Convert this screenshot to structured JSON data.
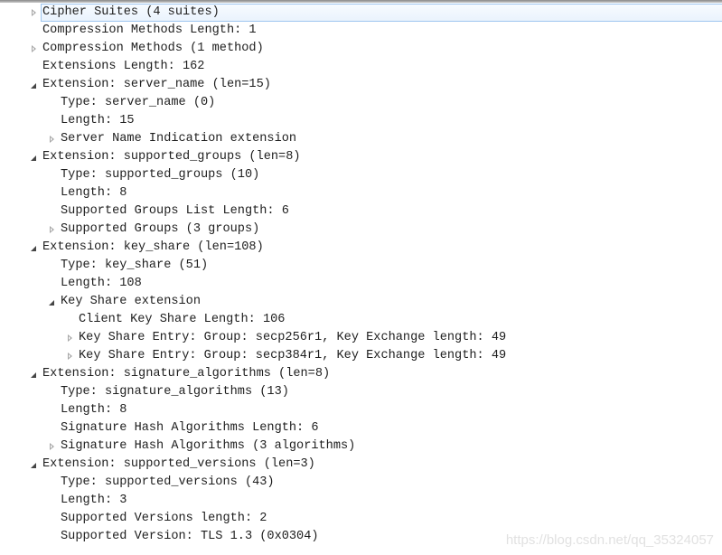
{
  "tree": {
    "rows": [
      {
        "level": 0,
        "toggle": "collapsed",
        "selected": true,
        "text": "Cipher Suites (4 suites)"
      },
      {
        "level": 0,
        "toggle": "none",
        "selected": false,
        "text": "Compression Methods Length: 1"
      },
      {
        "level": 0,
        "toggle": "collapsed",
        "selected": false,
        "text": "Compression Methods (1 method)"
      },
      {
        "level": 0,
        "toggle": "none",
        "selected": false,
        "text": "Extensions Length: 162"
      },
      {
        "level": 0,
        "toggle": "expanded",
        "selected": false,
        "text": "Extension: server_name (len=15)"
      },
      {
        "level": 1,
        "toggle": "none",
        "selected": false,
        "text": "Type: server_name (0)"
      },
      {
        "level": 1,
        "toggle": "none",
        "selected": false,
        "text": "Length: 15"
      },
      {
        "level": 1,
        "toggle": "collapsed",
        "selected": false,
        "text": "Server Name Indication extension"
      },
      {
        "level": 0,
        "toggle": "expanded",
        "selected": false,
        "text": "Extension: supported_groups (len=8)"
      },
      {
        "level": 1,
        "toggle": "none",
        "selected": false,
        "text": "Type: supported_groups (10)"
      },
      {
        "level": 1,
        "toggle": "none",
        "selected": false,
        "text": "Length: 8"
      },
      {
        "level": 1,
        "toggle": "none",
        "selected": false,
        "text": "Supported Groups List Length: 6"
      },
      {
        "level": 1,
        "toggle": "collapsed",
        "selected": false,
        "text": "Supported Groups (3 groups)"
      },
      {
        "level": 0,
        "toggle": "expanded",
        "selected": false,
        "text": "Extension: key_share (len=108)"
      },
      {
        "level": 1,
        "toggle": "none",
        "selected": false,
        "text": "Type: key_share (51)"
      },
      {
        "level": 1,
        "toggle": "none",
        "selected": false,
        "text": "Length: 108"
      },
      {
        "level": 1,
        "toggle": "expanded",
        "selected": false,
        "text": "Key Share extension"
      },
      {
        "level": 2,
        "toggle": "none",
        "selected": false,
        "text": "Client Key Share Length: 106"
      },
      {
        "level": 2,
        "toggle": "collapsed",
        "selected": false,
        "text": "Key Share Entry: Group: secp256r1, Key Exchange length: 49"
      },
      {
        "level": 2,
        "toggle": "collapsed",
        "selected": false,
        "text": "Key Share Entry: Group: secp384r1, Key Exchange length: 49"
      },
      {
        "level": 0,
        "toggle": "expanded",
        "selected": false,
        "text": "Extension: signature_algorithms (len=8)"
      },
      {
        "level": 1,
        "toggle": "none",
        "selected": false,
        "text": "Type: signature_algorithms (13)"
      },
      {
        "level": 1,
        "toggle": "none",
        "selected": false,
        "text": "Length: 8"
      },
      {
        "level": 1,
        "toggle": "none",
        "selected": false,
        "text": "Signature Hash Algorithms Length: 6"
      },
      {
        "level": 1,
        "toggle": "collapsed",
        "selected": false,
        "text": "Signature Hash Algorithms (3 algorithms)"
      },
      {
        "level": 0,
        "toggle": "expanded",
        "selected": false,
        "text": "Extension: supported_versions (len=3)"
      },
      {
        "level": 1,
        "toggle": "none",
        "selected": false,
        "text": "Type: supported_versions (43)"
      },
      {
        "level": 1,
        "toggle": "none",
        "selected": false,
        "text": "Length: 3"
      },
      {
        "level": 1,
        "toggle": "none",
        "selected": false,
        "text": "Supported Versions length: 2"
      },
      {
        "level": 1,
        "toggle": "none",
        "selected": false,
        "text": "Supported Version: TLS 1.3 (0x0304)"
      }
    ]
  },
  "colors": {
    "selection_border": "#9fc6ef",
    "selection_fill": "#eaf3fd",
    "text": "#1e1e1e",
    "toggle_collapsed": "#a6a6a6",
    "toggle_expanded": "#454545"
  },
  "icons": {
    "collapsed": "expand-triangle-icon",
    "expanded": "collapse-triangle-icon"
  },
  "watermark": "https://blog.csdn.net/qq_35324057"
}
